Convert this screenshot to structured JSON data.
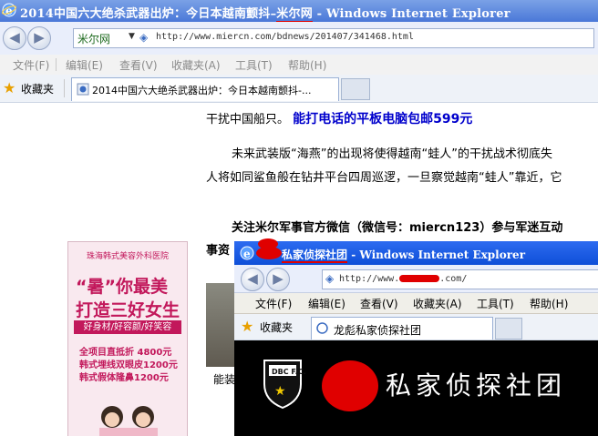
{
  "main_window": {
    "title_prefix": "2014中国六大绝杀武器出炉：今日本越南颤抖",
    "title_dash": "–",
    "title_site": "米尔网",
    "title_suffix": " - Windows Internet Explorer",
    "address": {
      "site_label": "米尔网",
      "url": "http://www.miercn.com/bdnews/201407/341468.html"
    },
    "menu": [
      "文件(F)",
      "编辑(E)",
      "查看(V)",
      "收藏夹(A)",
      "工具(T)",
      "帮助(H)"
    ],
    "favorites_label": "收藏夹",
    "tab_title": "2014中国六大绝杀武器出炉：今日本越南颤抖-..."
  },
  "article": {
    "line1_text": "干扰中国船只。",
    "line1_link": "能打电话的平板电脑包邮599元",
    "para2_line1": "未来武装版“海燕”的出现将使得越南“蛙人”的干扰战术彻底失",
    "para2_line2": "人将如同鲨鱼般在钻井平台四周巡逻，一旦察觉越南“蛙人”靠近，它",
    "follow_line": "关注米尔军事官方微信（微信号：miercn123）参与军迷互动",
    "partial_word": "事资",
    "thumb_caption": "能装"
  },
  "ad": {
    "logo_text": "珠海韩式美容外科医院",
    "headline1": "“暑”你最美",
    "headline2": "打造三好女生",
    "strip": "好身材/好容颜/好笑容",
    "offer1": "全项目直抵折 4800元",
    "offer2": "韩式埋线双眼皮1200元",
    "offer3": "韩式假体隆鼻1200元"
  },
  "popup_window": {
    "title_text": "私家侦探社团",
    "title_suffix": " - Windows Internet Explorer",
    "url_prefix": "http://www.",
    "url_suffix": ".com/",
    "menu": [
      "文件(F)",
      "编辑(E)",
      "查看(V)",
      "收藏夹(A)",
      "工具(T)",
      "帮助(H)"
    ],
    "favorites_label": "收藏夹",
    "tab_title": "龙彪私家侦探社团",
    "badge_text": "DBC F.C.",
    "brand_text": "私家侦探社团"
  },
  "colors": {
    "titlebar": "#4a78d8",
    "link_blue": "#0000cc",
    "redaction_red": "#e00000",
    "ad_pink": "#c2185b"
  },
  "icons": [
    "ie-logo-icon",
    "back-icon",
    "forward-icon",
    "star-icon",
    "globe-icon",
    "football-badge-icon"
  ]
}
